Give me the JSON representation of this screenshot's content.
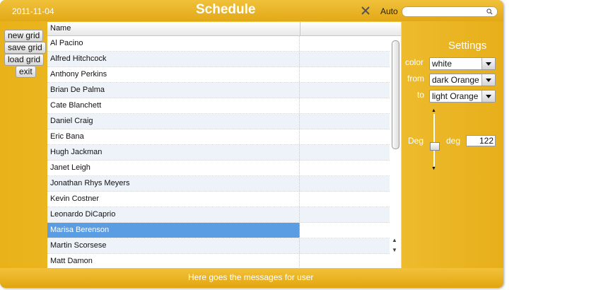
{
  "header": {
    "date": "2011-11-04",
    "title": "Schedule",
    "auto_label": "Auto",
    "search_placeholder": ""
  },
  "buttons": [
    "new grid",
    "save grid",
    "load grid",
    "exit"
  ],
  "grid": {
    "columns": [
      "Name",
      ""
    ],
    "rows": [
      "Al Pacino",
      "Alfred Hitchcock",
      "Anthony Perkins",
      "Brian De Palma",
      "Cate Blanchett",
      "Daniel Craig",
      "Eric Bana",
      "Hugh Jackman",
      "Janet Leigh",
      "Jonathan Rhys Meyers",
      "Kevin Costner",
      "Leonardo DiCaprio",
      "Marisa Berenson",
      "Martin Scorsese",
      "Matt Damon"
    ],
    "selected": "Marisa Berenson"
  },
  "settings": {
    "title": "Settings",
    "color_label": "color",
    "color_value": "white",
    "from_label": "from",
    "from_value": "dark Orange",
    "to_label": "to",
    "to_value": "light Orange",
    "deg_left_label": "Deg",
    "deg_label": "deg",
    "deg_value": "122"
  },
  "footer": {
    "message": "Here goes the messages for user"
  },
  "colors": {
    "accent": "#efc032",
    "selection": "#5b9de2"
  }
}
